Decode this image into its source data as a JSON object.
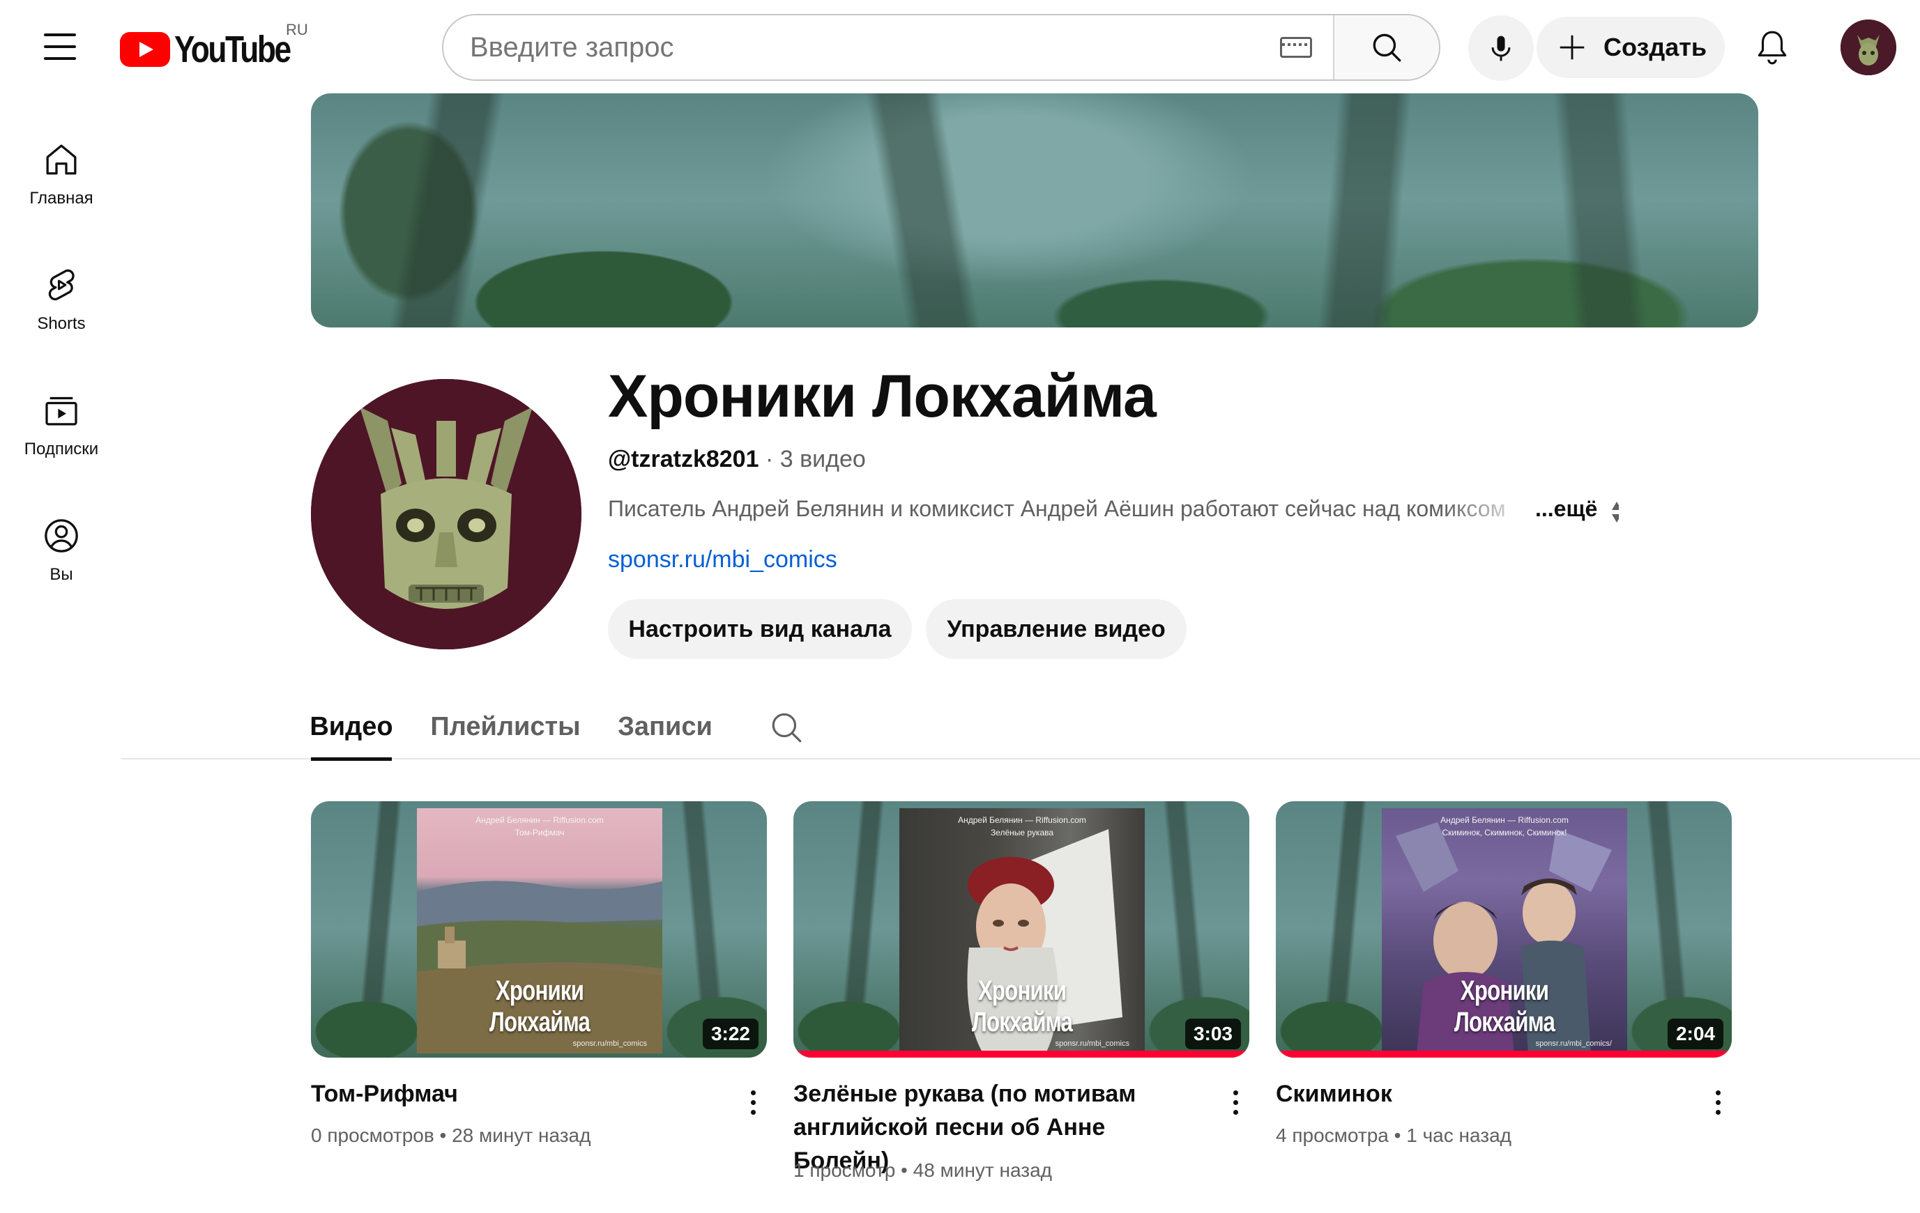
{
  "masthead": {
    "logo_text": "YouTube",
    "country_code": "RU",
    "search_placeholder": "Введите запрос",
    "create_label": "Создать"
  },
  "sidebar": {
    "items": [
      {
        "label": "Главная",
        "icon": "home-icon"
      },
      {
        "label": "Shorts",
        "icon": "shorts-icon"
      },
      {
        "label": "Подписки",
        "icon": "subscriptions-icon"
      },
      {
        "label": "Вы",
        "icon": "you-icon"
      }
    ]
  },
  "channel": {
    "title": "Хроники Локхайма",
    "handle": "@tzratzk8201",
    "video_count": "3 видео",
    "separator": "·",
    "description": "Писатель Андрей Белянин и комиксист Андрей Аёшин работают сейчас над комиксом",
    "more_label": "...ещё",
    "link": "sponsr.ru/mbi_comics",
    "customize_button": "Настроить вид канала",
    "manage_button": "Управление видео"
  },
  "tabs": [
    {
      "label": "Видео",
      "active": true
    },
    {
      "label": "Плейлисты",
      "active": false
    },
    {
      "label": "Записи",
      "active": false
    }
  ],
  "videos": [
    {
      "title": "Том-Рифмач",
      "views": "0 просмотров",
      "age": "28 минут назад",
      "duration": "3:22",
      "poster_author": "Андрей Белянин — Riffusion.com",
      "poster_subtitle": "Том-Рифмач",
      "poster_title": "Хроники Локхайма",
      "poster_site": "sponsr.ru/mbi_comics",
      "watched_fraction": 0
    },
    {
      "title": "Зелёные рукава (по мотивам английской песни об Анне Болейн)",
      "views": "1 просмотр",
      "age": "48 минут назад",
      "duration": "3:03",
      "poster_author": "Андрей Белянин — Riffusion.com",
      "poster_subtitle": "Зелёные рукава",
      "poster_title": "Хроники Локхайма",
      "poster_site": "sponsr.ru/mbi_comics",
      "watched_fraction": 1
    },
    {
      "title": "Скиминок",
      "views": "4 просмотра",
      "age": "1 час назад",
      "duration": "2:04",
      "poster_author": "Андрей Белянин — Riffusion.com",
      "poster_subtitle": "Скиминок, Скиминок, Скиминок!",
      "poster_title": "Хроники Локхайма",
      "poster_site": "sponsr.ru/mbi_comics/",
      "watched_fraction": 1
    }
  ],
  "meta_separator": "•",
  "colors": {
    "brand_red": "#ff0000",
    "link_blue": "#065fd4",
    "progress_red": "#ff0033",
    "chip_gray": "#f2f2f2",
    "avatar_maroon": "#4e1526"
  }
}
